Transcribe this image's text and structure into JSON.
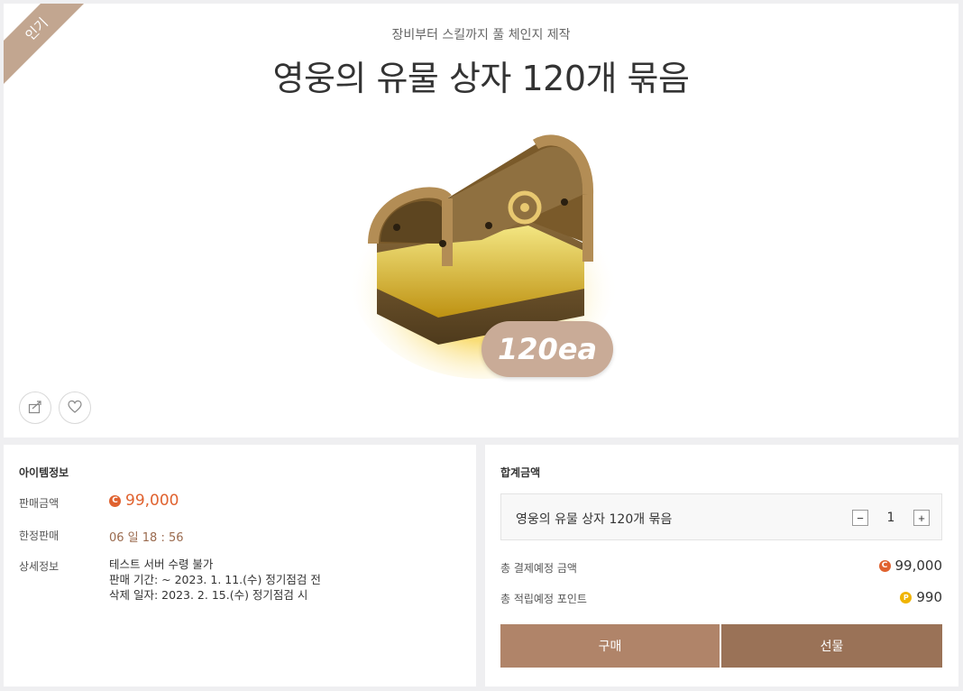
{
  "product": {
    "badge": "인기",
    "subtitle": "장비부터 스킬까지 풀 체인지 제작",
    "title": "영웅의 유물 상자 120개 묶음",
    "quantity_badge": "120ea",
    "image_icon": "treasure-chest-icon"
  },
  "actions": {
    "share_icon": "share-icon",
    "like_icon": "heart-icon"
  },
  "item_info": {
    "section_title": "아이템정보",
    "price_label": "판매금액",
    "price_value": "99,000",
    "limited_label": "한정판매",
    "limited_value": "06 일 18 : 56",
    "detail_label": "상세정보",
    "detail_lines": [
      "테스트 서버 수령 불가",
      "판매 기간: ~ 2023. 1. 11.(수) 정기점검 전",
      "삭제 일자: 2023. 2. 15.(수) 정기점검 시"
    ]
  },
  "summary": {
    "section_title": "합계금액",
    "item_name": "영웅의 유물 상자 120개 묶음",
    "minus": "−",
    "plus": "+",
    "quantity": "1",
    "total_label": "총 결제예정 금액",
    "total_value": "99,000",
    "points_label": "총 적립예정 포인트",
    "points_value": "990",
    "buy_label": "구매",
    "gift_label": "선물"
  },
  "colors": {
    "accent_price": "#e0622f",
    "point_coin": "#f0b400",
    "buy_button": "#b08469",
    "gift_button": "#9a7257",
    "ribbon": "#c2a690"
  }
}
